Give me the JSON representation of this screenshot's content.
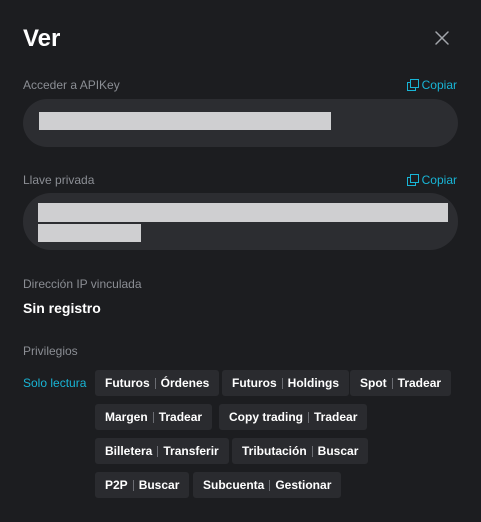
{
  "dialog": {
    "title": "Ver"
  },
  "api_key": {
    "label": "Acceder a APIKey",
    "copy_label": "Copiar"
  },
  "private_key": {
    "label": "Llave privada",
    "copy_label": "Copiar"
  },
  "ip": {
    "label": "Dirección IP vinculada",
    "value": "Sin registro"
  },
  "privileges": {
    "label": "Privilegios",
    "readonly_label": "Solo lectura",
    "items": [
      {
        "category": "Futuros",
        "action": "Órdenes"
      },
      {
        "category": "Futuros",
        "action": "Holdings"
      },
      {
        "category": "Spot",
        "action": "Tradear"
      },
      {
        "category": "Margen",
        "action": "Tradear"
      },
      {
        "category": "Copy trading",
        "action": "Tradear"
      },
      {
        "category": "Billetera",
        "action": "Transferir"
      },
      {
        "category": "Tributación",
        "action": "Buscar"
      },
      {
        "category": "P2P",
        "action": "Buscar"
      },
      {
        "category": "Subcuenta",
        "action": "Gestionar"
      }
    ]
  },
  "colors": {
    "accent": "#18b5d6",
    "background": "#1c1d20",
    "field": "#2c2d31",
    "chip": "#2a2b2f"
  },
  "icons": {
    "close": "close-icon",
    "copy": "copy-icon"
  }
}
